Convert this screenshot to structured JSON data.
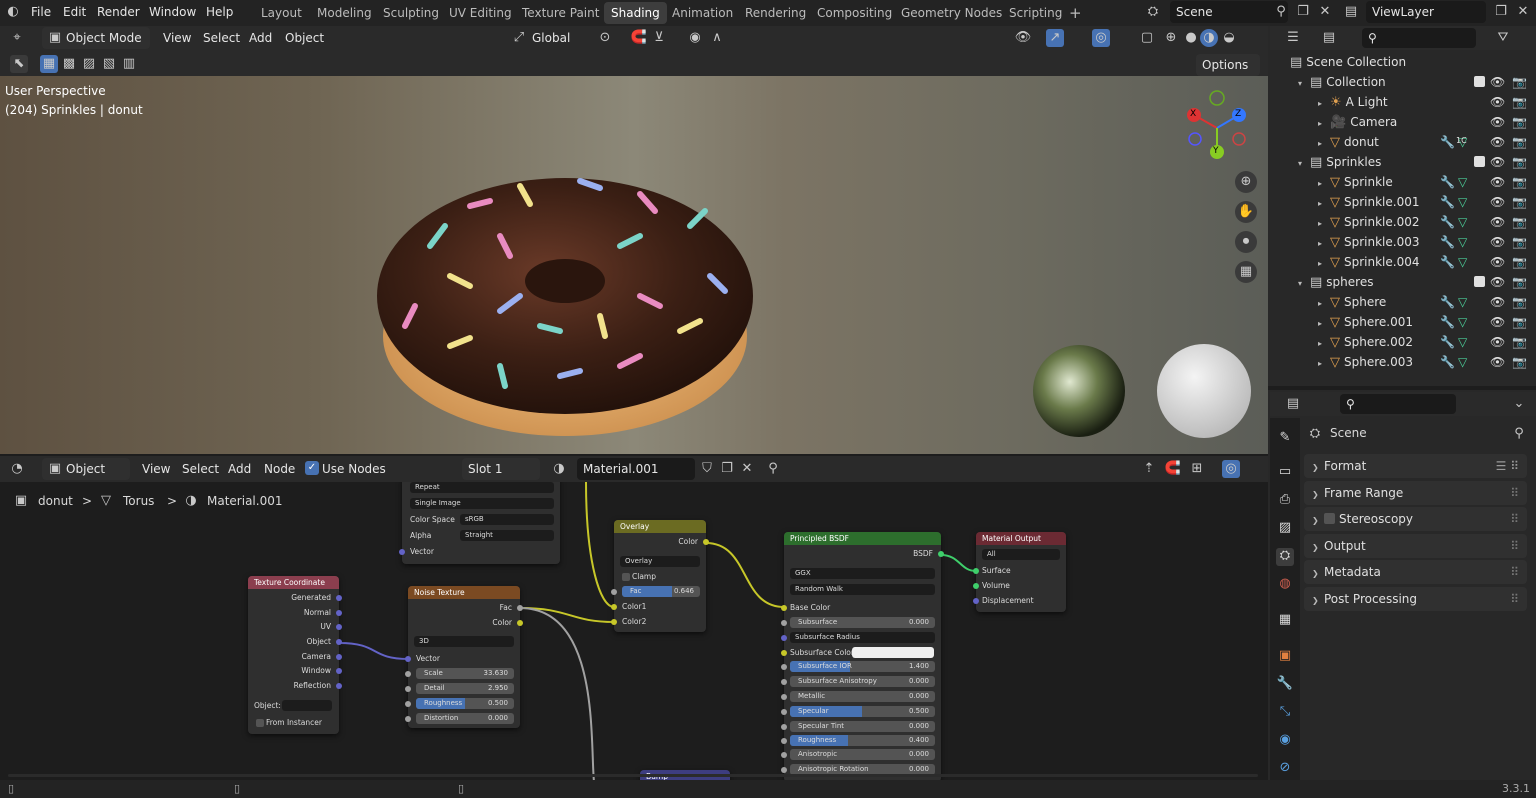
{
  "menubar": {
    "items": [
      "File",
      "Edit",
      "Render",
      "Window",
      "Help"
    ],
    "workspaces": [
      "Layout",
      "Modeling",
      "Sculpting",
      "UV Editing",
      "Texture Paint",
      "Shading",
      "Animation",
      "Rendering",
      "Compositing",
      "Geometry Nodes",
      "Scripting"
    ],
    "active_workspace": "Shading",
    "add_tab": "+",
    "scene": "Scene",
    "view_layer": "ViewLayer"
  },
  "viewport_header": {
    "mode": "Object Mode",
    "menus": [
      "View",
      "Select",
      "Add",
      "Object"
    ],
    "transform_orientation": "Global",
    "options": "Options"
  },
  "viewport": {
    "perspective": "User Perspective",
    "object_info": "(204) Sprinkles | donut",
    "gizmo": {
      "x": "X",
      "y": "Y",
      "z": "Z"
    }
  },
  "node_header": {
    "type": "Object",
    "menus": [
      "View",
      "Select",
      "Add",
      "Node"
    ],
    "use_nodes": "Use Nodes",
    "slot": "Slot 1",
    "material": "Material.001"
  },
  "breadcrumb": {
    "object": "donut",
    "mesh": "Torus",
    "material": "Material.001"
  },
  "nodes": {
    "image_texture": {
      "repeat": "Repeat",
      "single_image": "Single Image",
      "color_space_label": "Color Space",
      "color_space": "sRGB",
      "alpha_label": "Alpha",
      "alpha": "Straight",
      "vector": "Vector"
    },
    "texture_coordinate": {
      "title": "Texture Coordinate",
      "outputs": [
        "Generated",
        "Normal",
        "UV",
        "Object",
        "Camera",
        "Window",
        "Reflection"
      ],
      "object_label": "Object:",
      "from_instancer": "From Instancer"
    },
    "noise_texture": {
      "title": "Noise Texture",
      "outputs": [
        "Fac",
        "Color"
      ],
      "dimensions": "3D",
      "vector": "Vector",
      "scale_label": "Scale",
      "scale": "33.630",
      "detail_label": "Detail",
      "detail": "2.950",
      "roughness_label": "Roughness",
      "roughness": "0.500",
      "distortion_label": "Distortion",
      "distortion": "0.000"
    },
    "overlay": {
      "title": "Overlay",
      "output": "Color",
      "blend": "Overlay",
      "clamp": "Clamp",
      "fac_label": "Fac",
      "fac": "0.646",
      "inputs": [
        "Color1",
        "Color2"
      ]
    },
    "principled": {
      "title": "Principled BSDF",
      "output": "BSDF",
      "distribution": "GGX",
      "subsurface_method": "Random Walk",
      "base_color": "Base Color",
      "rows": [
        {
          "label": "Subsurface",
          "value": "0.000"
        },
        {
          "label": "Subsurface Radius",
          "value": ""
        },
        {
          "label": "Subsurface Color",
          "value": ""
        },
        {
          "label": "Subsurface IOR",
          "value": "1.400"
        },
        {
          "label": "Subsurface Anisotropy",
          "value": "0.000"
        },
        {
          "label": "Metallic",
          "value": "0.000"
        },
        {
          "label": "Specular",
          "value": "0.500"
        },
        {
          "label": "Specular Tint",
          "value": "0.000"
        },
        {
          "label": "Roughness",
          "value": "0.400"
        },
        {
          "label": "Anisotropic",
          "value": "0.000"
        },
        {
          "label": "Anisotropic Rotation",
          "value": "0.000"
        }
      ]
    },
    "material_output": {
      "title": "Material Output",
      "target": "All",
      "inputs": [
        "Surface",
        "Volume",
        "Displacement"
      ]
    },
    "bump": {
      "title": "Bump"
    }
  },
  "outliner": {
    "root": "Scene Collection",
    "rows": [
      {
        "label": "Collection",
        "depth": 1,
        "kind": "collection"
      },
      {
        "label": "A Light",
        "depth": 2,
        "kind": "light"
      },
      {
        "label": "Camera",
        "depth": 2,
        "kind": "camera"
      },
      {
        "label": "donut",
        "depth": 2,
        "kind": "mesh"
      },
      {
        "label": "Sprinkles",
        "depth": 1,
        "kind": "collection"
      },
      {
        "label": "Sprinkle",
        "depth": 2,
        "kind": "mesh"
      },
      {
        "label": "Sprinkle.001",
        "depth": 2,
        "kind": "mesh"
      },
      {
        "label": "Sprinkle.002",
        "depth": 2,
        "kind": "mesh"
      },
      {
        "label": "Sprinkle.003",
        "depth": 2,
        "kind": "mesh"
      },
      {
        "label": "Sprinkle.004",
        "depth": 2,
        "kind": "mesh"
      },
      {
        "label": "spheres",
        "depth": 1,
        "kind": "collection"
      },
      {
        "label": "Sphere",
        "depth": 2,
        "kind": "mesh"
      },
      {
        "label": "Sphere.001",
        "depth": 2,
        "kind": "mesh"
      },
      {
        "label": "Sphere.002",
        "depth": 2,
        "kind": "mesh"
      },
      {
        "label": "Sphere.003",
        "depth": 2,
        "kind": "mesh"
      }
    ],
    "donut_modifier_badge": "1C"
  },
  "properties": {
    "context": "Scene",
    "panels": [
      "Format",
      "Frame Range",
      "Stereoscopy",
      "Output",
      "Metadata",
      "Post Processing"
    ]
  },
  "statusbar": {
    "version": "3.3.1"
  },
  "colors": {
    "accent": "#4772b3",
    "active_ws": "#3d3d3d",
    "panel": "#303030",
    "header": "#2a2a2a",
    "mesh_icon": "#e0a050",
    "node_header_texture": "#8b3e4e",
    "node_header_noise": "#7b4a22",
    "node_header_overlay": "#6b6b22",
    "node_header_shader": "#2d6e2d",
    "node_header_output": "#6b2a33"
  }
}
